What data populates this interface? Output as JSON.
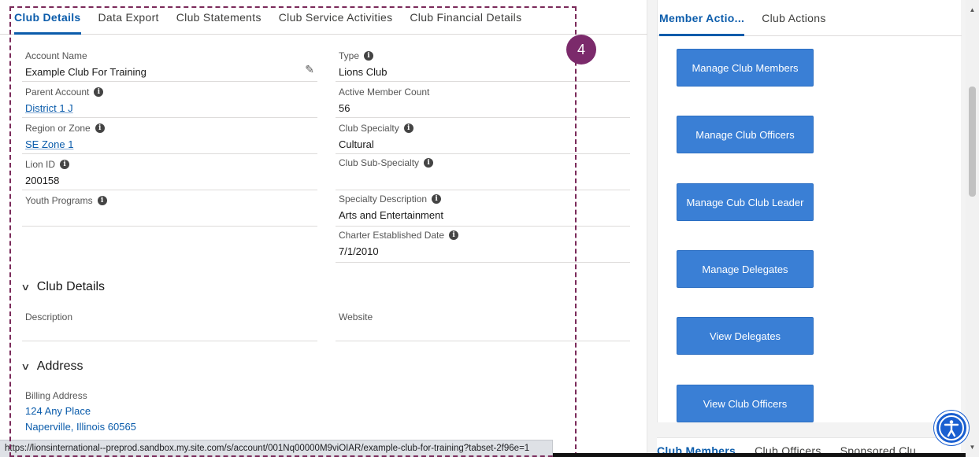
{
  "tabs": [
    {
      "label": "Club Details"
    },
    {
      "label": "Data Export"
    },
    {
      "label": "Club Statements"
    },
    {
      "label": "Club Service Activities"
    },
    {
      "label": "Club Financial Details"
    }
  ],
  "fields": {
    "account_name": {
      "label": "Account Name",
      "value": "Example Club For Training"
    },
    "type": {
      "label": "Type",
      "value": "Lions Club"
    },
    "parent_account": {
      "label": "Parent Account",
      "value": "District 1 J"
    },
    "active_member_count": {
      "label": "Active Member Count",
      "value": "56"
    },
    "region_zone": {
      "label": "Region or Zone",
      "value": "SE Zone 1"
    },
    "club_specialty": {
      "label": "Club Specialty",
      "value": "Cultural"
    },
    "lion_id": {
      "label": "Lion ID",
      "value": "200158"
    },
    "club_sub_specialty": {
      "label": "Club Sub-Specialty",
      "value": ""
    },
    "youth_programs": {
      "label": "Youth Programs",
      "value": ""
    },
    "specialty_description": {
      "label": "Specialty Description",
      "value": "Arts and Entertainment"
    },
    "charter_date": {
      "label": "Charter Established Date",
      "value": "7/1/2010"
    },
    "description": {
      "label": "Description",
      "value": ""
    },
    "website": {
      "label": "Website",
      "value": ""
    }
  },
  "sections": {
    "club_details": "Club Details",
    "address": "Address"
  },
  "address": {
    "label": "Billing Address",
    "line1": "124 Any Place",
    "line2": "Naperville, Illinois 60565"
  },
  "status_url": "https://lionsinternational--preprod.sandbox.my.site.com/s/account/001Nq00000M9viOIAR/example-club-for-training?tabset-2f96e=1",
  "callout_number": "4",
  "right_tabs": [
    {
      "label": "Member Actio..."
    },
    {
      "label": "Club Actions"
    }
  ],
  "actions": [
    "Manage Club Members",
    "Manage Club Officers",
    "Manage Cub Club Leader",
    "Manage Delegates",
    "View Delegates",
    "View Club Officers"
  ],
  "lower_tabs": [
    "Club Members",
    "Club Officers",
    "Sponsored Clu"
  ],
  "colors": {
    "accent": "#0b5cab",
    "button": "#3a7fd5",
    "callout": "#7b2a6b"
  }
}
